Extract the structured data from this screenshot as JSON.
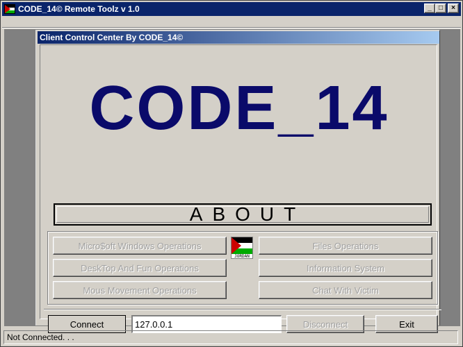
{
  "window": {
    "title": "CODE_14© Remote Toolz v 1.0",
    "buttons": [
      "_",
      "□",
      "×"
    ]
  },
  "child": {
    "title": "Client Control Center By  CODE_14©",
    "logo": "CODE_14"
  },
  "about": {
    "label": "ABOUT"
  },
  "operations": {
    "left": [
      "Micro$oft Windows Operations",
      "DeskTop And Fun Operations",
      "Mous Movement Operations"
    ],
    "right": [
      "Files Operations",
      "Information System",
      "Chat With Victim"
    ],
    "flag_caption": "JORDAN"
  },
  "controls": {
    "connect": "Connect",
    "ip": "127.0.0.1",
    "disconnect": "Disconnect",
    "exit": "Exit"
  },
  "status": {
    "text": "Not Connected. . ."
  },
  "colors": {
    "titlebar": "#0a246a",
    "logo": "#0a0a6a",
    "face": "#d4d0c8"
  }
}
